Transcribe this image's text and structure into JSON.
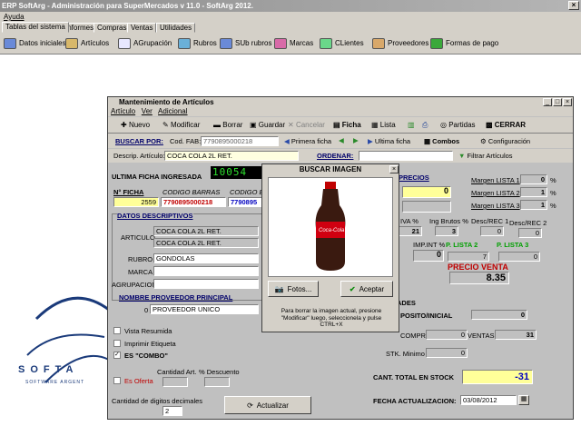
{
  "app": {
    "title": "ERP SoftArg - Administración para SuperMercados v 11.0 - SoftArg 2012.",
    "menu": [
      "Ayuda"
    ]
  },
  "tabs": [
    "Tablas del sistema",
    "Informes",
    "Compras",
    "Ventas",
    "Utilidades"
  ],
  "toolbar": [
    "Datos iniciales",
    "Artículos",
    "AGrupación",
    "Rubros",
    "SUb rubros",
    "Marcas",
    "CLientes",
    "Proveedores",
    "Formas de pago"
  ],
  "logo": {
    "brand": "SOFTA",
    "tagline": "SOFTWARE ARGENT"
  },
  "win": {
    "title": "Mantenimiento de Artículos",
    "menu": [
      "Artículo",
      "Ver",
      "Adicional"
    ],
    "tools": [
      "Nuevo",
      "Modificar",
      "Borrar",
      "Guardar",
      "Cancelar",
      "Ficha",
      "Lista",
      "Partidas",
      "CERRAR"
    ],
    "buscar_label": "BUSCAR POR:",
    "codfab_label": "Cod. FAB:",
    "codfab_value": "7790895000218",
    "primera_ficha": "Primera ficha",
    "ultima_ficha": "Ultima ficha",
    "combos": "Combos",
    "configuracion": "Configuración",
    "descrip_label": "Descrip. Artículo:",
    "descrip_value": "COCA COLA 2L RET.",
    "ordenar_label": "ORDENAR:",
    "filtrar": "Filtrar Artículos"
  },
  "form": {
    "ultima_label": "ULTIMA FICHA INGRESADA",
    "ultima_value": "10054",
    "nficha_label": "N° FICHA",
    "nficha_value": "2559",
    "codbar_label": "CODIGO BARRAS",
    "codbar_value": "7790895000218",
    "codig_label": "CODIGO E",
    "codig_value": "7790895",
    "datos_label": "DATOS DESCRIPTIVOS",
    "articulo_label": "ARTICULO",
    "articulo_1": "COCA COLA 2L RET.",
    "articulo_2": "COCA COLA 2L RET.",
    "rubro_label": "RUBRO",
    "rubro_value": "GONDOLAS",
    "marca_label": "MARCA",
    "agrupacion_label": "AGRUPACION",
    "proveedor_label": "NOMBRE PROVEEDOR PRINCIPAL",
    "proveedor_num": "0",
    "proveedor_value": "PROVEEDOR UNICO",
    "vista_resumida": "Vista Resumida",
    "imprimir_etiqueta": "Imprimir Etiqueta",
    "es_combo": "ES \"COMBO\"",
    "es_oferta": "Es Oferta",
    "cantidad_art": "Cantidad Art.",
    "pct_desc": "% Descuento",
    "cant_dig_label": "Cantidad de digitos decimales",
    "cant_dig_value": "2",
    "actualizar": "Actualizar",
    "precios_label": "PRECIOS",
    "precio_val_1": "0",
    "margen1": "Margen LISTA 1",
    "margen2": "Margen LISTA 2",
    "margen3": "Margen LISTA 3",
    "m1": "0",
    "m2": "1",
    "m3": "1",
    "pct": "%",
    "iva_label": "IVA %",
    "iva_value": "21",
    "ing_label": "Ing Brutos %",
    "ing_value": "3",
    "descrec1": "Desc/REC 1",
    "descrec2": "Desc/REC 2",
    "dr1": "0",
    "dr2": "0",
    "impint_label": "IMP.INT %",
    "impint_value": "0",
    "plista2": "P. LISTA 2",
    "plista3": "P. LISTA 3",
    "pl2": "7",
    "pl3": "0",
    "pventa_label": "PRECIO VENTA",
    "pventa_value": "8.35",
    "ades": "ADES",
    "deposito_label": "POSITO/INICIAL",
    "deposito_value": "0",
    "comprada_label": "COMPRADA",
    "comprada_value": "0",
    "ventas_label": "VENTAS",
    "ventas_value": "31",
    "stk_label": "STK. Minimo",
    "stk_value": "0",
    "cant_total_label": "CANT. TOTAL EN STOCK",
    "cant_total_value": "-31",
    "fecha_label": "FECHA ACTUALIZACION:",
    "fecha_value": "03/08/2012"
  },
  "popup": {
    "title": "BUSCAR IMAGEN",
    "fotos": "Fotos...",
    "aceptar": "Aceptar",
    "hint": "Para borrar la imagen actual, presione \"Modificar\" luego, seleccionela y pulse CTRL+X",
    "bottle_label": "Coca-Cola"
  }
}
